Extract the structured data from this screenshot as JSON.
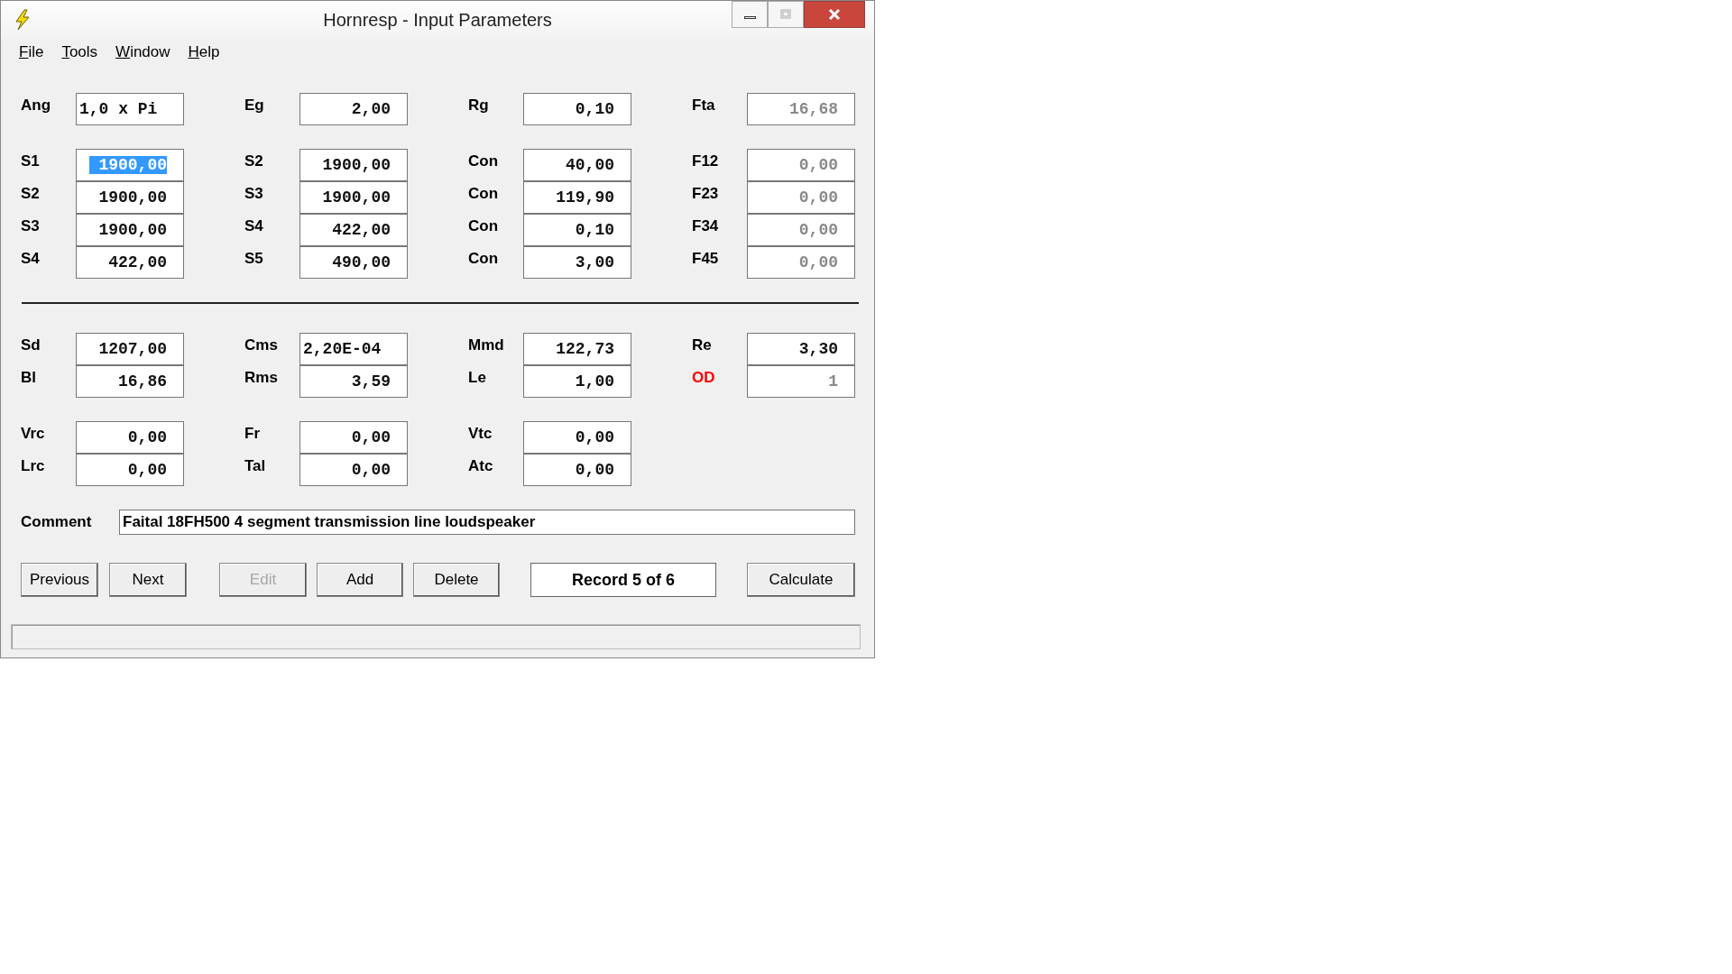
{
  "window": {
    "title": "Hornresp - Input Parameters"
  },
  "menu": [
    {
      "label": "File"
    },
    {
      "label": "Tools"
    },
    {
      "label": "Window"
    },
    {
      "label": "Help"
    }
  ],
  "blocks": [
    {
      "rows": [
        [
          {
            "label": "Ang",
            "value": "1,0 x Pi",
            "kind": "text",
            "disabled": false,
            "selected": false,
            "alert": false
          },
          {
            "label": "Eg",
            "value": "2,00",
            "kind": "number",
            "disabled": false,
            "selected": false,
            "alert": false
          },
          {
            "label": "Rg",
            "value": "0,10",
            "kind": "number",
            "disabled": false,
            "selected": false,
            "alert": false
          },
          {
            "label": "Fta",
            "value": "16,68",
            "kind": "number",
            "disabled": true,
            "selected": false,
            "alert": false
          }
        ]
      ]
    },
    {
      "rows": [
        [
          {
            "label": "S1",
            "value": "1900,00",
            "kind": "number",
            "disabled": false,
            "selected": true,
            "alert": false
          },
          {
            "label": "S2",
            "value": "1900,00",
            "kind": "number",
            "disabled": false,
            "selected": false,
            "alert": false
          },
          {
            "label": "Con",
            "value": "40,00",
            "kind": "number",
            "disabled": false,
            "selected": false,
            "alert": false
          },
          {
            "label": "F12",
            "value": "0,00",
            "kind": "number",
            "disabled": true,
            "selected": false,
            "alert": false
          }
        ],
        [
          {
            "label": "S2",
            "value": "1900,00",
            "kind": "number",
            "disabled": false,
            "selected": false,
            "alert": false
          },
          {
            "label": "S3",
            "value": "1900,00",
            "kind": "number",
            "disabled": false,
            "selected": false,
            "alert": false
          },
          {
            "label": "Con",
            "value": "119,90",
            "kind": "number",
            "disabled": false,
            "selected": false,
            "alert": false
          },
          {
            "label": "F23",
            "value": "0,00",
            "kind": "number",
            "disabled": true,
            "selected": false,
            "alert": false
          }
        ],
        [
          {
            "label": "S3",
            "value": "1900,00",
            "kind": "number",
            "disabled": false,
            "selected": false,
            "alert": false
          },
          {
            "label": "S4",
            "value": "422,00",
            "kind": "number",
            "disabled": false,
            "selected": false,
            "alert": false
          },
          {
            "label": "Con",
            "value": "0,10",
            "kind": "number",
            "disabled": false,
            "selected": false,
            "alert": false
          },
          {
            "label": "F34",
            "value": "0,00",
            "kind": "number",
            "disabled": true,
            "selected": false,
            "alert": false
          }
        ],
        [
          {
            "label": "S4",
            "value": "422,00",
            "kind": "number",
            "disabled": false,
            "selected": false,
            "alert": false
          },
          {
            "label": "S5",
            "value": "490,00",
            "kind": "number",
            "disabled": false,
            "selected": false,
            "alert": false
          },
          {
            "label": "Con",
            "value": "3,00",
            "kind": "number",
            "disabled": false,
            "selected": false,
            "alert": false
          },
          {
            "label": "F45",
            "value": "0,00",
            "kind": "number",
            "disabled": true,
            "selected": false,
            "alert": false
          }
        ]
      ],
      "rule_after": true
    },
    {
      "rows": [
        [
          {
            "label": "Sd",
            "value": "1207,00",
            "kind": "number",
            "disabled": false,
            "selected": false,
            "alert": false
          },
          {
            "label": "Cms",
            "value": "2,20E-04",
            "kind": "text",
            "disabled": false,
            "selected": false,
            "alert": false
          },
          {
            "label": "Mmd",
            "value": "122,73",
            "kind": "number",
            "disabled": false,
            "selected": false,
            "alert": false
          },
          {
            "label": "Re",
            "value": "3,30",
            "kind": "number",
            "disabled": false,
            "selected": false,
            "alert": false
          }
        ],
        [
          {
            "label": "Bl",
            "value": "16,86",
            "kind": "number",
            "disabled": false,
            "selected": false,
            "alert": false
          },
          {
            "label": "Rms",
            "value": "3,59",
            "kind": "number",
            "disabled": false,
            "selected": false,
            "alert": false
          },
          {
            "label": "Le",
            "value": "1,00",
            "kind": "number",
            "disabled": false,
            "selected": false,
            "alert": false
          },
          {
            "label": "OD",
            "value": "1",
            "kind": "number",
            "disabled": true,
            "selected": false,
            "alert": true
          }
        ]
      ]
    },
    {
      "rows": [
        [
          {
            "label": "Vrc",
            "value": "0,00",
            "kind": "number",
            "disabled": false,
            "selected": false,
            "alert": false
          },
          {
            "label": "Fr",
            "value": "0,00",
            "kind": "number",
            "disabled": false,
            "selected": false,
            "alert": false
          },
          {
            "label": "Vtc",
            "value": "0,00",
            "kind": "number",
            "disabled": false,
            "selected": false,
            "alert": false
          }
        ],
        [
          {
            "label": "Lrc",
            "value": "0,00",
            "kind": "number",
            "disabled": false,
            "selected": false,
            "alert": false
          },
          {
            "label": "Tal",
            "value": "0,00",
            "kind": "number",
            "disabled": false,
            "selected": false,
            "alert": false
          },
          {
            "label": "Atc",
            "value": "0,00",
            "kind": "number",
            "disabled": false,
            "selected": false,
            "alert": false
          }
        ]
      ]
    }
  ],
  "comment": {
    "label": "Comment",
    "value": "Faital 18FH500 4 segment transmission line loudspeaker"
  },
  "buttons": [
    {
      "kind": "button",
      "label": "Previous",
      "disabled": false
    },
    {
      "kind": "button",
      "label": "Next",
      "disabled": false
    },
    {
      "kind": "button",
      "label": "Edit",
      "disabled": true
    },
    {
      "kind": "button",
      "label": "Add",
      "disabled": false
    },
    {
      "kind": "button",
      "label": "Delete",
      "disabled": false
    },
    {
      "kind": "display",
      "label": "Record 5 of 6"
    },
    {
      "kind": "button",
      "label": "Calculate",
      "disabled": false
    }
  ]
}
